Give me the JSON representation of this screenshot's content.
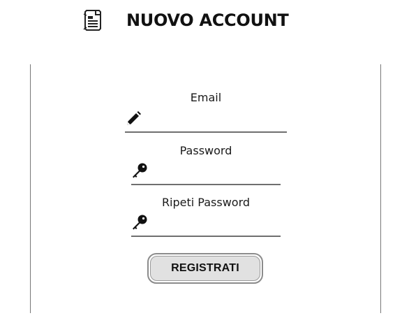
{
  "header": {
    "icon": "document-icon",
    "title": "NUOVO ACCOUNT"
  },
  "form": {
    "email": {
      "label": "Email",
      "icon": "pencil-icon",
      "value": "",
      "placeholder": ""
    },
    "password": {
      "label": "Password",
      "icon": "key-icon",
      "value": "",
      "placeholder": ""
    },
    "repeat_password": {
      "label": "Ripeti Password",
      "icon": "key-icon",
      "value": "",
      "placeholder": ""
    },
    "submit_label": "REGISTRATI"
  }
}
